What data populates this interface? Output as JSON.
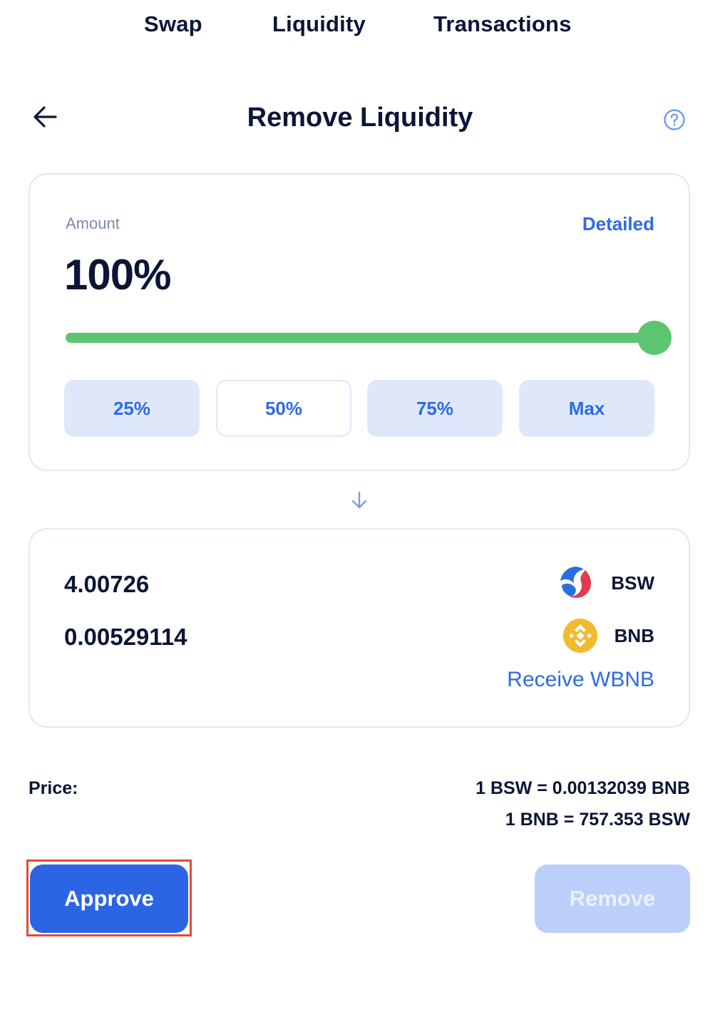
{
  "nav": {
    "tabs": [
      {
        "label": "Swap"
      },
      {
        "label": "Liquidity"
      },
      {
        "label": "Transactions"
      }
    ]
  },
  "header": {
    "title": "Remove Liquidity",
    "back_icon": "arrow-left-icon",
    "help_icon": "question-circle-icon"
  },
  "amount_card": {
    "label": "Amount",
    "detailed_link": "Detailed",
    "value": "100%",
    "slider_fraction": 1.0,
    "presets": [
      {
        "label": "25%"
      },
      {
        "label": "50%"
      },
      {
        "label": "75%"
      },
      {
        "label": "Max"
      }
    ]
  },
  "output_card": {
    "tokens": [
      {
        "amount": "4.00726",
        "symbol": "BSW",
        "icon": "bsw-token-icon"
      },
      {
        "amount": "0.00529114",
        "symbol": "BNB",
        "icon": "bnb-token-icon"
      }
    ],
    "receive_link": "Receive WBNB"
  },
  "price": {
    "label": "Price:",
    "lines": [
      "1 BSW = 0.00132039 BNB",
      "1 BNB = 757.353 BSW"
    ]
  },
  "actions": {
    "approve_label": "Approve",
    "remove_label": "Remove"
  },
  "colors": {
    "accent": "#2c65e4",
    "slider": "#5bc56f",
    "text": "#0b1536",
    "highlight": "#e04a34",
    "preset_bg": "#dfe8fb"
  }
}
